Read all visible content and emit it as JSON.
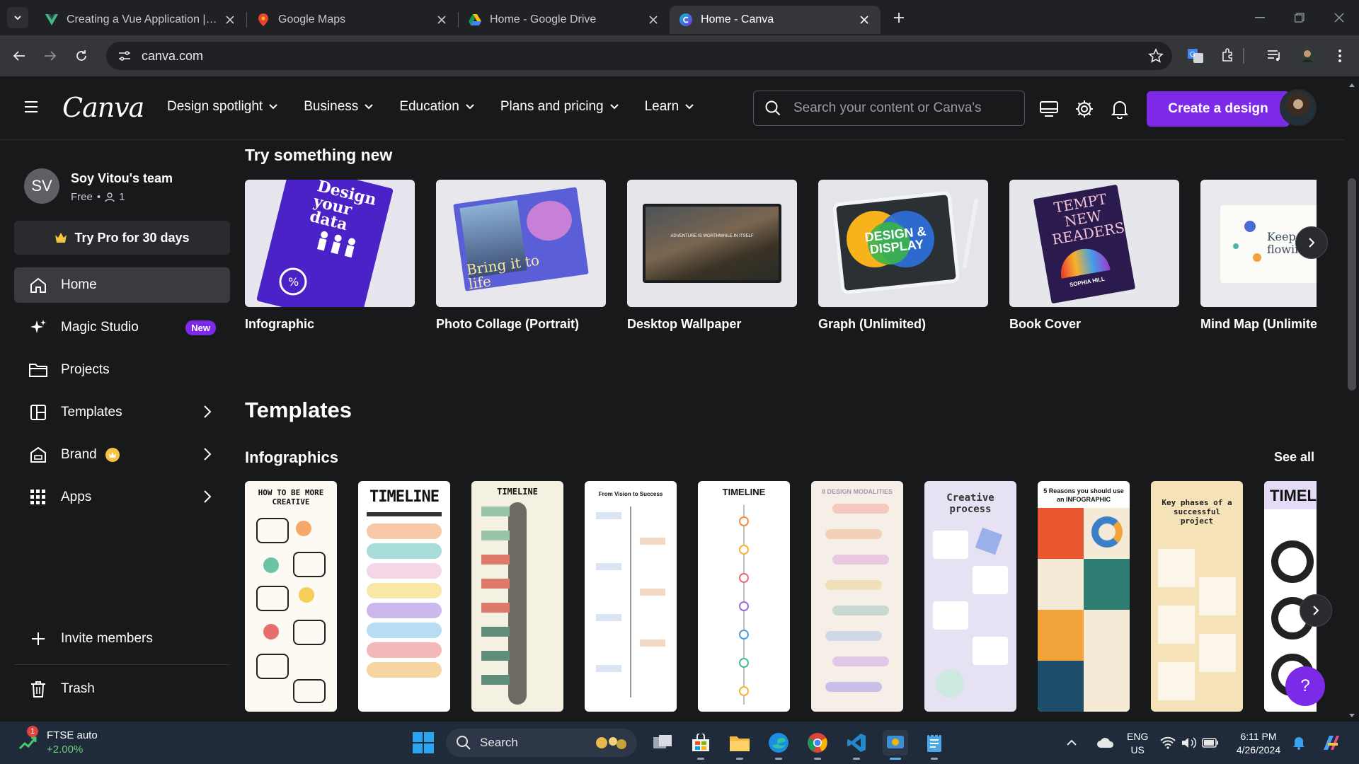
{
  "browser": {
    "tabs": [
      {
        "title": "Creating a Vue Application | Vu",
        "favicon": "vue-icon",
        "active": false
      },
      {
        "title": "Google Maps",
        "favicon": "maps-icon",
        "active": false
      },
      {
        "title": "Home - Google Drive",
        "favicon": "drive-icon",
        "active": false
      },
      {
        "title": "Home - Canva",
        "favicon": "canva-icon",
        "active": true
      }
    ],
    "url": "canva.com"
  },
  "header": {
    "logo": "Canva",
    "nav": [
      "Design spotlight",
      "Business",
      "Education",
      "Plans and pricing",
      "Learn"
    ],
    "search_placeholder": "Search your content or Canva's",
    "create_label": "Create a design"
  },
  "sidebar": {
    "team_initials": "SV",
    "team_name": "Soy Vitou's team",
    "plan": "Free",
    "member_count": "1",
    "try_pro": "Try Pro for 30 days",
    "items": [
      {
        "label": "Home",
        "icon": "home-icon",
        "active": true
      },
      {
        "label": "Magic Studio",
        "icon": "sparkle-icon",
        "badge": "New"
      },
      {
        "label": "Projects",
        "icon": "folder-icon"
      },
      {
        "label": "Templates",
        "icon": "templates-icon",
        "chevron": true
      },
      {
        "label": "Brand",
        "icon": "brand-icon",
        "chevron": true
      },
      {
        "label": "Apps",
        "icon": "apps-icon",
        "chevron": true
      }
    ],
    "invite": "Invite members",
    "trash": "Trash"
  },
  "main": {
    "try_heading": "Try something new",
    "design_types": [
      "Infographic",
      "Photo Collage (Portrait)",
      "Desktop Wallpaper",
      "Graph (Unlimited)",
      "Book Cover",
      "Mind Map (Unlimited)"
    ],
    "thumb_text": {
      "infographic": "Design your data",
      "collage": "Bring it to life",
      "wallpaper": "ADVENTURE IS WORTHWHILE IN ITSELF",
      "graph": "DESIGN & DISPLAY",
      "book": "TEMPT NEW READERS",
      "book_author": "SOPHIA HILL",
      "mindmap": "Keep ideas flowing"
    },
    "templates_heading": "Templates",
    "infographics_heading": "Infographics",
    "see_all": "See all",
    "template_titles": [
      "HOW TO BE MORE CREATIVE",
      "TIMELINE",
      "TIMELINE",
      "From Vision to Success",
      "TIMELINE",
      "8 DESIGN MODALITIES",
      "Creative process",
      "5 Reasons you should use an INFOGRAPHIC",
      "Key phases of a successful project",
      "TIMELINE"
    ],
    "help": "?"
  },
  "taskbar": {
    "weather_title": "FTSE auto",
    "weather_sub": "+2.00%",
    "weather_badge": "1",
    "search": "Search",
    "lang_top": "ENG",
    "lang_bottom": "US",
    "time": "6:11 PM",
    "date": "4/26/2024"
  },
  "colors": {
    "accent": "#7d2ae8",
    "bg": "#18191b"
  }
}
